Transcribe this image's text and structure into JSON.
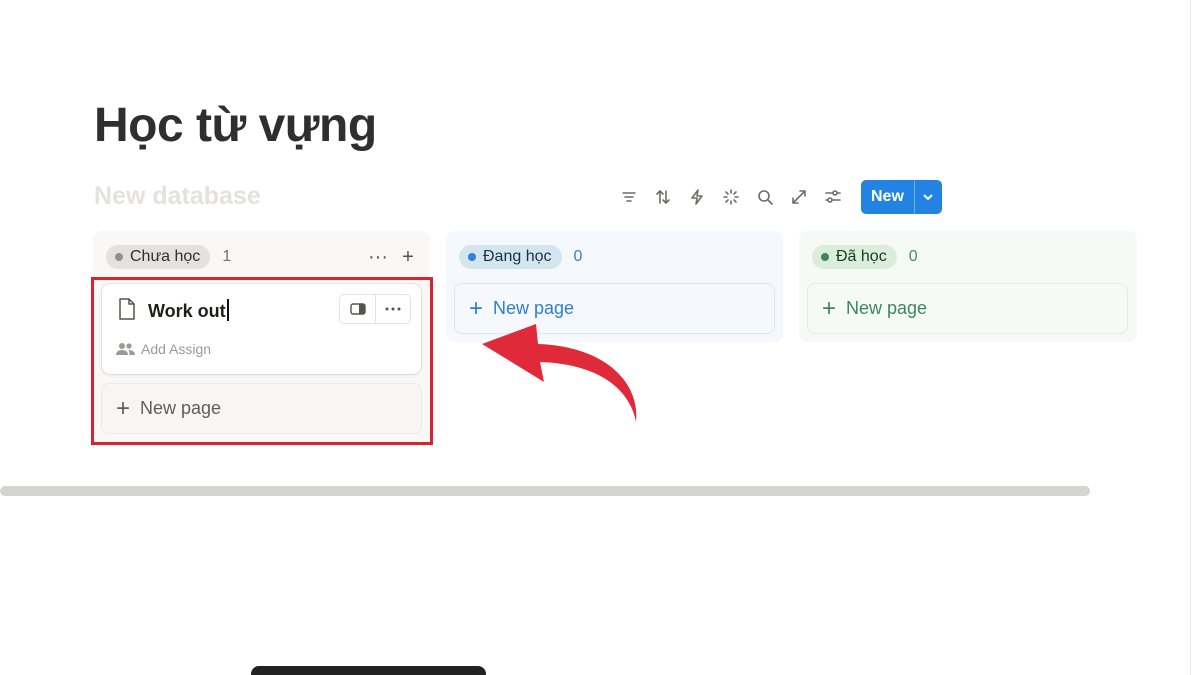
{
  "page": {
    "title": "Học từ vựng",
    "database_title": "New database"
  },
  "toolbar": {
    "icons": [
      "filter-icon",
      "sort-icon",
      "automation-icon",
      "ai-icon",
      "search-icon",
      "expand-icon",
      "settings-icon"
    ],
    "new_label": "New"
  },
  "board": {
    "columns": [
      {
        "label": "Chưa học",
        "count": "1",
        "color": "#91918e",
        "new_page": "New page",
        "card": {
          "title": "Work out",
          "property": "Add Assign"
        }
      },
      {
        "label": "Đang học",
        "count": "0",
        "color": "#2f80d9",
        "new_page": "New page"
      },
      {
        "label": "Đã học",
        "count": "0",
        "color": "#448361",
        "new_page": "New page"
      }
    ],
    "column_actions": {
      "more": "···",
      "add": "+"
    }
  },
  "annotation": {
    "highlight_color": "#d9232d",
    "arrow_color": "#e02a3a"
  }
}
